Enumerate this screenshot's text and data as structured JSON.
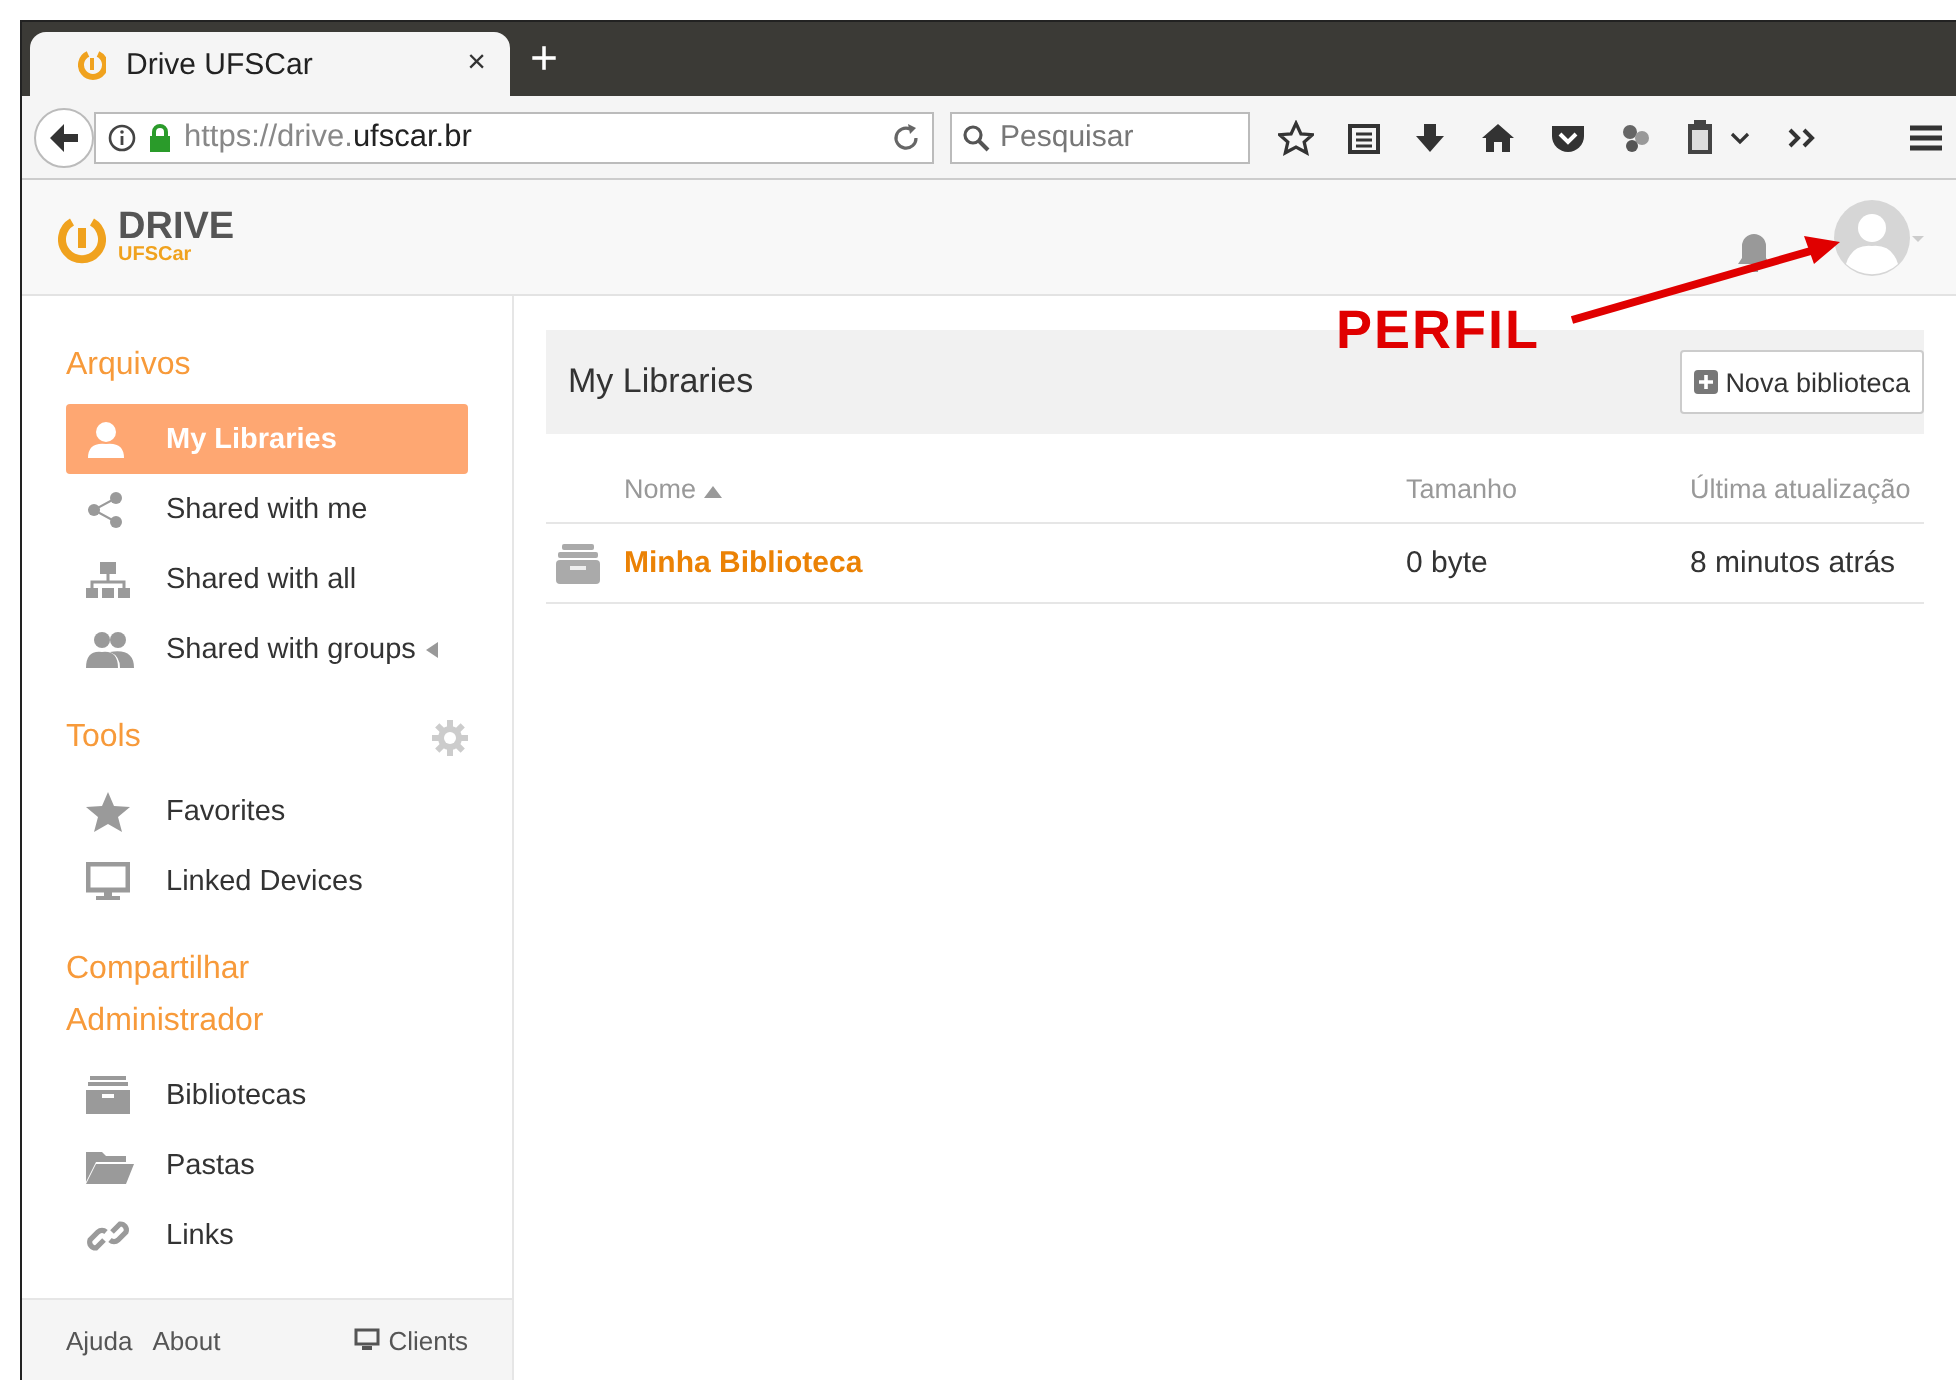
{
  "browser": {
    "tab_title": "Drive UFSCar",
    "new_tab": "+",
    "tab_close": "×",
    "url_prefix": "https://drive.",
    "url_domain": "ufscar.br",
    "search_placeholder": "Pesquisar"
  },
  "header": {
    "logo_title": "DRIVE",
    "logo_subtitle": "UFSCar"
  },
  "annotation": {
    "text": "PERFIL"
  },
  "sidebar": {
    "sections": [
      {
        "title": "Arquivos",
        "has_settings": false,
        "items": [
          {
            "label": "My Libraries",
            "kind": "user",
            "selected": true,
            "expandable": false
          },
          {
            "label": "Shared with me",
            "kind": "share",
            "selected": false,
            "expandable": false
          },
          {
            "label": "Shared with all",
            "kind": "hierarchy",
            "selected": false,
            "expandable": false
          },
          {
            "label": "Shared with groups",
            "kind": "group",
            "selected": false,
            "expandable": true
          }
        ]
      },
      {
        "title": "Tools",
        "has_settings": true,
        "items": [
          {
            "label": "Favorites",
            "kind": "star",
            "selected": false,
            "expandable": false
          },
          {
            "label": "Linked Devices",
            "kind": "monitor",
            "selected": false,
            "expandable": false
          }
        ]
      },
      {
        "title": "Compartilhar Administrador",
        "has_settings": false,
        "items": [
          {
            "label": "Bibliotecas",
            "kind": "archive",
            "selected": false,
            "expandable": false
          },
          {
            "label": "Pastas",
            "kind": "folder",
            "selected": false,
            "expandable": false
          },
          {
            "label": "Links",
            "kind": "link",
            "selected": false,
            "expandable": false
          }
        ]
      }
    ],
    "footer": {
      "help": "Ajuda",
      "about": "About",
      "clients": "Clients"
    }
  },
  "main": {
    "title": "My Libraries",
    "new_button": "Nova biblioteca",
    "table": {
      "columns": [
        "Nome",
        "Tamanho",
        "Última atualização"
      ],
      "rows": [
        {
          "name": "Minha Biblioteca",
          "size": "0 byte",
          "updated": "8 minutos atrás"
        }
      ]
    }
  }
}
